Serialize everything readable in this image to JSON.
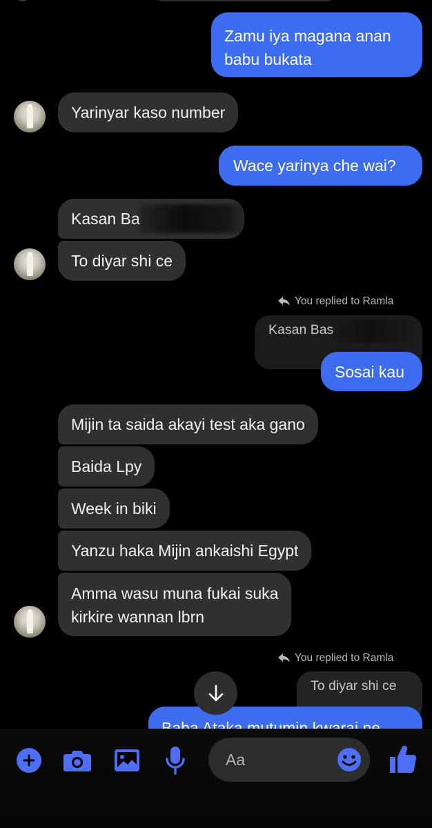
{
  "messages": {
    "sent_1_line1": "Zamu iya magana anan",
    "sent_1_line2": "babu bukata",
    "recv_1": "Yarinyar kaso number",
    "sent_2": "Wace yarinya che wai?",
    "recv_2": "Kasan Ba",
    "recv_3": "To diyar shi ce",
    "reply_1_label": "You replied to Ramla",
    "reply_1_quote": "Kasan Bas",
    "sent_3": "Sosai kau",
    "recv_4": "Mijin ta saida akayi test aka gano",
    "recv_5": "Baida Lpy",
    "recv_6": "Week in biki",
    "recv_7": "Yanzu haka Mijin ankaishi Egypt",
    "recv_8_line1": "Amma wasu muna fukai suka",
    "recv_8_line2": "kirkire wannan lbrn",
    "reply_2_label": "You replied to Ramla",
    "reply_2_quote": "To diyar shi ce",
    "sent_4_partial": "Baba Ataka mutumin kwarai ne"
  },
  "composer": {
    "placeholder": "Aa"
  },
  "colors": {
    "sent_bubble": "#3d6cf0",
    "received_bubble": "#303030",
    "accent": "#4d6ef5"
  },
  "icons": [
    "plus-icon",
    "camera-icon",
    "image-icon",
    "microphone-icon",
    "emoji-icon",
    "thumbs-up-icon",
    "arrow-down-icon",
    "reply-arrow-icon"
  ]
}
